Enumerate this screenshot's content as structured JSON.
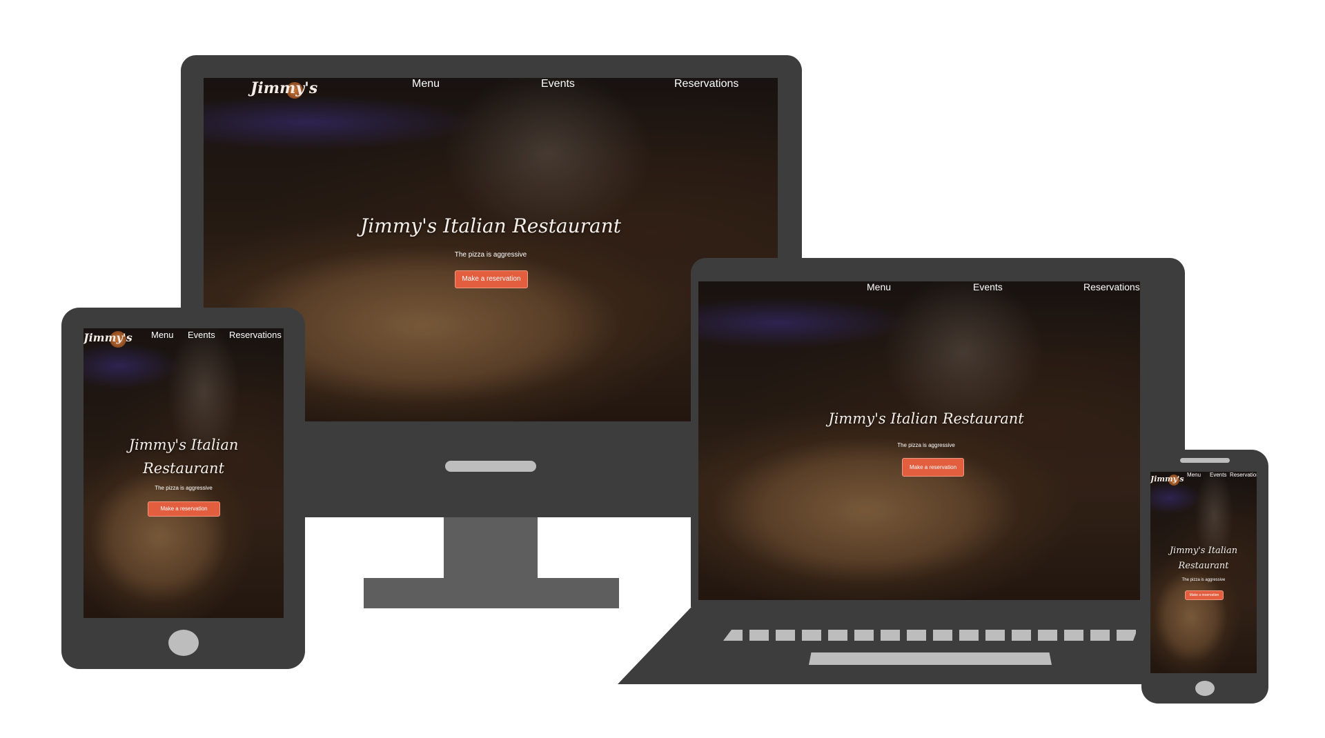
{
  "site": {
    "logo": "Jimmy's",
    "nav": [
      "Menu",
      "Events",
      "Reservations"
    ],
    "hero_title": "Jimmy's Italian Restaurant",
    "hero_title_line1": "Jimmy's Italian",
    "hero_title_line2": "Restaurant",
    "tagline": "The pizza is aggressive",
    "cta": "Make a reservation"
  },
  "colors": {
    "device_frame": "#3d3d3d",
    "button_accent": "#e35d3f",
    "device_button": "#bdbdbd"
  }
}
